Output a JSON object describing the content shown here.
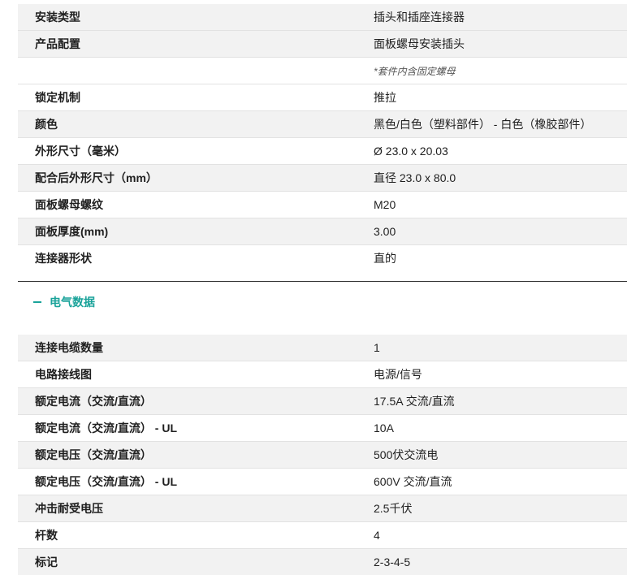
{
  "mechanical": {
    "rows": [
      {
        "key": "安装类型",
        "value": "插头和插座连接器"
      },
      {
        "key": "产品配置",
        "value": "面板螺母安装插头"
      },
      {
        "key": "",
        "value": "*套件内含固定螺母"
      },
      {
        "key": "锁定机制",
        "value": "推拉"
      },
      {
        "key": "颜色",
        "value": "黑色/白色（塑料部件） - 白色（橡胶部件）"
      },
      {
        "key": "外形尺寸（毫米）",
        "value": "Ø 23.0 x 20.03"
      },
      {
        "key": "配合后外形尺寸（mm）",
        "value": "直径 23.0 x 80.0"
      },
      {
        "key": "面板螺母螺纹",
        "value": "M20"
      },
      {
        "key": "面板厚度(mm)",
        "value": "3.00"
      },
      {
        "key": "连接器形状",
        "value": "直的"
      }
    ]
  },
  "electrical": {
    "title": "电气数据",
    "rows": [
      {
        "key": "连接电缆数量",
        "value": "1"
      },
      {
        "key": "电路接线图",
        "value": "电源/信号"
      },
      {
        "key": "额定电流（交流/直流）",
        "value": "17.5A 交流/直流"
      },
      {
        "key": "额定电流（交流/直流） - UL",
        "value": "10A"
      },
      {
        "key": "额定电压（交流/直流）",
        "value": "500伏交流电"
      },
      {
        "key": "额定电压（交流/直流） - UL",
        "value": "600V 交流/直流"
      },
      {
        "key": "冲击耐受电压",
        "value": "2.5千伏"
      },
      {
        "key": "杆数",
        "value": "4"
      },
      {
        "key": "标记",
        "value": "2-3-4-5"
      }
    ]
  },
  "colors": {
    "accent": "#1aa39a",
    "stripe": "#f2f2f2",
    "divider": "#e2e2e2"
  },
  "icons": {
    "section_toggle": "minus-icon"
  }
}
